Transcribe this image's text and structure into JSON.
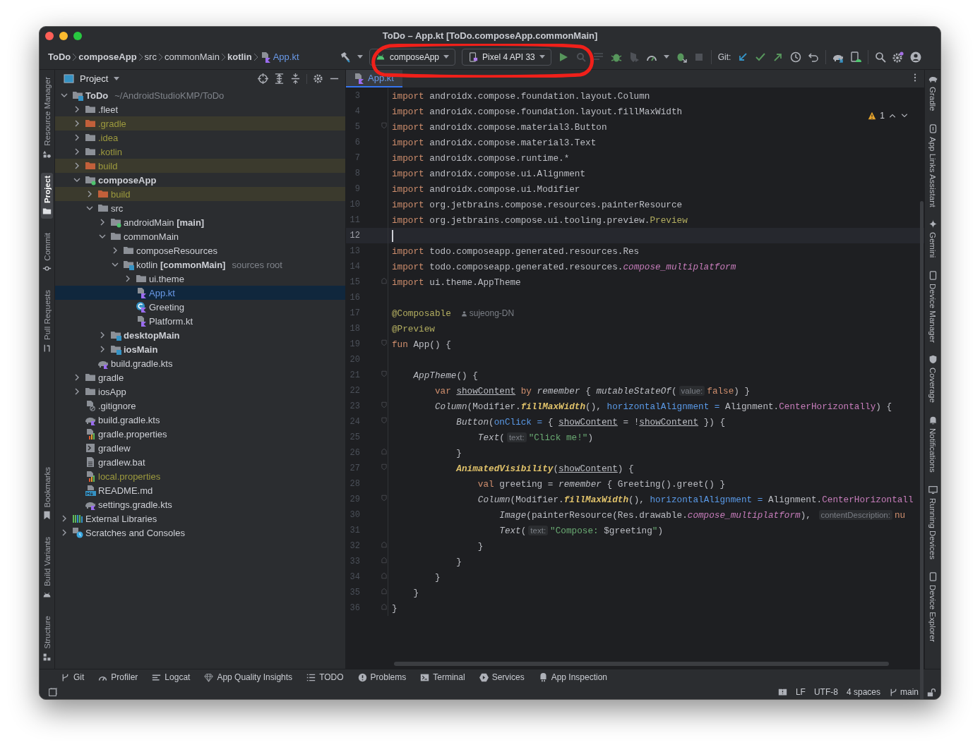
{
  "window": {
    "title": "ToDo – App.kt [ToDo.composeApp.commonMain]"
  },
  "breadcrumbs": [
    {
      "label": "ToDo",
      "bold": true
    },
    {
      "label": "composeApp",
      "bold": true
    },
    {
      "label": "src",
      "bold": false
    },
    {
      "label": "commonMain",
      "bold": false
    },
    {
      "label": "kotlin",
      "bold": true
    },
    {
      "label": "App.kt",
      "bold": false,
      "kind": "kotlin-file"
    }
  ],
  "run_config": {
    "label": "composeApp"
  },
  "device": {
    "label": "Pixel 4 API 33"
  },
  "git_label": "Git:",
  "left_stripe": {
    "top": [
      {
        "kind": "resources",
        "label": "Resource Manager",
        "selected": false
      },
      {
        "kind": "project",
        "label": "Project",
        "selected": true
      },
      {
        "kind": "commit",
        "label": "Commit",
        "selected": false
      },
      {
        "kind": "pull",
        "label": "Pull Requests",
        "selected": false
      }
    ],
    "bottom": [
      {
        "kind": "bookmark",
        "label": "Bookmarks",
        "selected": false
      },
      {
        "kind": "variants",
        "label": "Build Variants",
        "selected": false
      },
      {
        "kind": "structure",
        "label": "Structure",
        "selected": false
      }
    ]
  },
  "project_panel": {
    "title": "Project",
    "tree": [
      {
        "label": "ToDo",
        "hint": "~/AndroidStudioKMP/ToDo",
        "kind": "source-folder",
        "bold": true,
        "ignored": false,
        "expanded": true,
        "selected": false,
        "children": [
          {
            "label": ".fleet",
            "kind": "folder",
            "bold": false,
            "ignored": false,
            "expanded": false,
            "selected": false
          },
          {
            "label": ".gradle",
            "kind": "excluded-folder",
            "bold": false,
            "ignored": true,
            "expanded": false,
            "selected": false
          },
          {
            "label": ".idea",
            "kind": "folder",
            "bold": false,
            "ignored": true,
            "expanded": false,
            "selected": false
          },
          {
            "label": ".kotlin",
            "kind": "folder",
            "bold": false,
            "ignored": true,
            "expanded": false,
            "selected": false
          },
          {
            "label": "build",
            "kind": "excluded-folder",
            "bold": false,
            "ignored": true,
            "expanded": false,
            "selected": false
          },
          {
            "label": "composeApp",
            "kind": "android-folder",
            "bold": true,
            "ignored": false,
            "expanded": true,
            "selected": false,
            "children": [
              {
                "label": "build",
                "kind": "excluded-folder",
                "bold": false,
                "ignored": true,
                "expanded": false,
                "selected": false
              },
              {
                "label": "src",
                "kind": "folder",
                "bold": false,
                "ignored": false,
                "expanded": true,
                "selected": false,
                "children": [
                  {
                    "label": "androidMain **[main]**",
                    "kind": "android-folder",
                    "bold": false,
                    "ignored": false,
                    "expanded": false,
                    "selected": false
                  },
                  {
                    "label": "commonMain",
                    "kind": "folder",
                    "bold": false,
                    "ignored": false,
                    "expanded": true,
                    "selected": false,
                    "children": [
                      {
                        "label": "composeResources",
                        "kind": "folder",
                        "bold": false,
                        "ignored": false,
                        "expanded": false,
                        "selected": false
                      },
                      {
                        "label": "kotlin **[commonMain]**",
                        "hint": "sources root",
                        "kind": "source-folder",
                        "bold": false,
                        "ignored": false,
                        "expanded": true,
                        "selected": false,
                        "children": [
                          {
                            "label": "ui.theme",
                            "kind": "folder",
                            "bold": false,
                            "ignored": false,
                            "expanded": false,
                            "selected": false
                          },
                          {
                            "label": "App.kt",
                            "kind": "kotlin-file",
                            "bold": false,
                            "ignored": false,
                            "selected": true
                          },
                          {
                            "label": "Greeting",
                            "kind": "kotlin-class",
                            "bold": false,
                            "ignored": false,
                            "selected": false
                          },
                          {
                            "label": "Platform.kt",
                            "kind": "kotlin-file",
                            "bold": false,
                            "ignored": false,
                            "selected": false
                          }
                        ]
                      }
                    ]
                  },
                  {
                    "label": "desktopMain",
                    "kind": "source-folder",
                    "bold": true,
                    "ignored": false,
                    "expanded": false,
                    "selected": false
                  },
                  {
                    "label": "iosMain",
                    "kind": "source-folder",
                    "bold": true,
                    "ignored": false,
                    "expanded": false,
                    "selected": false
                  }
                ]
              },
              {
                "label": "build.gradle.kts",
                "kind": "gradle-file",
                "bold": false,
                "ignored": false,
                "selected": false
              }
            ]
          },
          {
            "label": "gradle",
            "kind": "folder",
            "bold": false,
            "ignored": false,
            "expanded": false,
            "selected": false
          },
          {
            "label": "iosApp",
            "kind": "folder",
            "bold": false,
            "ignored": false,
            "expanded": false,
            "selected": false
          },
          {
            "label": ".gitignore",
            "kind": "ignore-file",
            "bold": false,
            "ignored": false,
            "selected": false
          },
          {
            "label": "build.gradle.kts",
            "kind": "gradle-file",
            "bold": false,
            "ignored": false,
            "selected": false
          },
          {
            "label": "gradle.properties",
            "kind": "properties-file",
            "bold": false,
            "ignored": false,
            "selected": false
          },
          {
            "label": "gradlew",
            "kind": "shell-file",
            "bold": false,
            "ignored": false,
            "selected": false
          },
          {
            "label": "gradlew.bat",
            "kind": "text-file",
            "bold": false,
            "ignored": false,
            "selected": false
          },
          {
            "label": "local.properties",
            "kind": "properties-file",
            "bold": false,
            "ignored": true,
            "selected": false
          },
          {
            "label": "README.md",
            "kind": "markdown-file",
            "bold": false,
            "ignored": false,
            "selected": false
          },
          {
            "label": "settings.gradle.kts",
            "kind": "gradle-file",
            "bold": false,
            "ignored": false,
            "selected": false
          }
        ]
      },
      {
        "label": "External Libraries",
        "kind": "libraries",
        "bold": false,
        "ignored": false,
        "expanded": false,
        "selected": false
      },
      {
        "label": "Scratches and Consoles",
        "kind": "scratches",
        "bold": false,
        "ignored": false,
        "expanded": false,
        "selected": false
      }
    ]
  },
  "editor": {
    "tabs": [
      {
        "label": "App.kt",
        "selected": true
      }
    ],
    "warnings": "1",
    "lines": [
      {
        "n": "3",
        "current": false,
        "tokens": [
          {
            "kind": "kw",
            "text": "import"
          },
          {
            "kind": "plain",
            "text": " androidx.compose.foundation.layout.Column"
          }
        ]
      },
      {
        "n": "4",
        "current": false,
        "tokens": [
          {
            "kind": "kw",
            "text": "import"
          },
          {
            "kind": "plain",
            "text": " androidx.compose.foundation.layout.fillMaxWidth"
          }
        ]
      },
      {
        "n": "5",
        "current": false,
        "fold_start": true,
        "fold_end": false,
        "tokens": [
          {
            "kind": "kw",
            "text": "import"
          },
          {
            "kind": "plain",
            "text": " androidx.compose.material3.Button"
          }
        ]
      },
      {
        "n": "6",
        "current": false,
        "tokens": [
          {
            "kind": "kw",
            "text": "import"
          },
          {
            "kind": "plain",
            "text": " androidx.compose.material3.Text"
          }
        ]
      },
      {
        "n": "7",
        "current": false,
        "tokens": [
          {
            "kind": "kw",
            "text": "import"
          },
          {
            "kind": "plain",
            "text": " androidx.compose.runtime.*"
          }
        ]
      },
      {
        "n": "8",
        "current": false,
        "tokens": [
          {
            "kind": "kw",
            "text": "import"
          },
          {
            "kind": "plain",
            "text": " androidx.compose.ui.Alignment"
          }
        ]
      },
      {
        "n": "9",
        "current": false,
        "tokens": [
          {
            "kind": "kw",
            "text": "import"
          },
          {
            "kind": "plain",
            "text": " androidx.compose.ui.Modifier"
          }
        ]
      },
      {
        "n": "10",
        "current": false,
        "tokens": [
          {
            "kind": "kw",
            "text": "import"
          },
          {
            "kind": "plain",
            "text": " org.jetbrains.compose.resources.painterResource"
          }
        ]
      },
      {
        "n": "11",
        "current": false,
        "tokens": [
          {
            "kind": "kw",
            "text": "import"
          },
          {
            "kind": "plain",
            "text": " org.jetbrains.compose.ui.tooling.preview."
          },
          {
            "kind": "ann",
            "text": "Preview"
          }
        ]
      },
      {
        "n": "12",
        "current": true
      },
      {
        "n": "13",
        "current": false,
        "tokens": [
          {
            "kind": "kw",
            "text": "import"
          },
          {
            "kind": "plain",
            "text": " todo.composeapp.generated.resources.Res"
          }
        ]
      },
      {
        "n": "14",
        "current": false,
        "tokens": [
          {
            "kind": "kw",
            "text": "import"
          },
          {
            "kind": "plain",
            "text": " todo.composeapp.generated.resources."
          },
          {
            "kind": "propi",
            "text": "compose_multiplatform"
          }
        ]
      },
      {
        "n": "15",
        "current": false,
        "fold_start": false,
        "fold_end": true,
        "tokens": [
          {
            "kind": "kw",
            "text": "import"
          },
          {
            "kind": "plain",
            "text": " ui.theme.AppTheme"
          }
        ]
      },
      {
        "n": "16",
        "current": false
      },
      {
        "n": "17",
        "current": false,
        "tokens": [
          {
            "kind": "ann",
            "text": "@Composable"
          },
          {
            "kind": "author",
            "text": "sujeong-DN"
          }
        ]
      },
      {
        "n": "18",
        "current": false,
        "tokens": [
          {
            "kind": "ann",
            "text": "@Preview"
          }
        ]
      },
      {
        "n": "19",
        "current": false,
        "fold_start": true,
        "fold_end": false,
        "tokens": [
          {
            "kind": "kw",
            "text": "fun"
          },
          {
            "kind": "plain",
            "text": " App() {"
          }
        ]
      },
      {
        "n": "20",
        "current": false
      },
      {
        "n": "21",
        "current": false,
        "fold_start": true,
        "fold_end": false,
        "tokens": [
          {
            "kind": "ital",
            "text": "    AppTheme"
          },
          {
            "kind": "plain",
            "text": "() {"
          }
        ]
      },
      {
        "n": "22",
        "current": false,
        "tokens": [
          {
            "kind": "kw",
            "text": "        var "
          },
          {
            "kind": "under",
            "text": "showContent"
          },
          {
            "kind": "kw",
            "text": " by "
          },
          {
            "kind": "ital",
            "text": "remember"
          },
          {
            "kind": "plain",
            "text": " { "
          },
          {
            "kind": "ital",
            "text": "mutableStateOf"
          },
          {
            "kind": "plain",
            "text": "("
          },
          {
            "kind": "hint",
            "text": "value:"
          },
          {
            "kind": "kw",
            "text": "false"
          },
          {
            "kind": "plain",
            "text": ") }"
          }
        ]
      },
      {
        "n": "23",
        "current": false,
        "fold_start": true,
        "fold_end": false,
        "tokens": [
          {
            "kind": "ital",
            "text": "        Column"
          },
          {
            "kind": "plain",
            "text": "(Modifier."
          },
          {
            "kind": "fnc",
            "text": "fillMaxWidth"
          },
          {
            "kind": "plain",
            "text": "(), "
          },
          {
            "kind": "named",
            "text": "horizontalAlignment ="
          },
          {
            "kind": "plain",
            "text": " Alignment."
          },
          {
            "kind": "prop",
            "text": "CenterHorizontally"
          },
          {
            "kind": "plain",
            "text": ") {"
          }
        ]
      },
      {
        "n": "24",
        "current": false,
        "fold_start": true,
        "fold_end": false,
        "tokens": [
          {
            "kind": "ital",
            "text": "            Button"
          },
          {
            "kind": "plain",
            "text": "("
          },
          {
            "kind": "named",
            "text": "onClick ="
          },
          {
            "kind": "plain",
            "text": " { "
          },
          {
            "kind": "under",
            "text": "showContent"
          },
          {
            "kind": "plain",
            "text": " = !"
          },
          {
            "kind": "under",
            "text": "showContent"
          },
          {
            "kind": "plain",
            "text": " }) {"
          }
        ]
      },
      {
        "n": "25",
        "current": false,
        "tokens": [
          {
            "kind": "ital",
            "text": "                Text"
          },
          {
            "kind": "plain",
            "text": "("
          },
          {
            "kind": "hint",
            "text": "text:"
          },
          {
            "kind": "str",
            "text": "\"Click me!\""
          },
          {
            "kind": "plain",
            "text": ")"
          }
        ]
      },
      {
        "n": "26",
        "current": false,
        "fold_start": false,
        "fold_end": true,
        "tokens": [
          {
            "kind": "plain",
            "text": "            }"
          }
        ]
      },
      {
        "n": "27",
        "current": false,
        "fold_start": true,
        "fold_end": false,
        "tokens": [
          {
            "kind": "fnc",
            "text": "            AnimatedVisibility"
          },
          {
            "kind": "plain",
            "text": "("
          },
          {
            "kind": "under",
            "text": "showContent"
          },
          {
            "kind": "plain",
            "text": ") {"
          }
        ]
      },
      {
        "n": "28",
        "current": false,
        "tokens": [
          {
            "kind": "kw",
            "text": "                val"
          },
          {
            "kind": "plain",
            "text": " greeting = "
          },
          {
            "kind": "ital",
            "text": "remember"
          },
          {
            "kind": "plain",
            "text": " { Greeting().greet() }"
          }
        ]
      },
      {
        "n": "29",
        "current": false,
        "fold_start": true,
        "fold_end": false,
        "tokens": [
          {
            "kind": "ital",
            "text": "                Column"
          },
          {
            "kind": "plain",
            "text": "(Modifier."
          },
          {
            "kind": "fnc",
            "text": "fillMaxWidth"
          },
          {
            "kind": "plain",
            "text": "(), "
          },
          {
            "kind": "named",
            "text": "horizontalAlignment ="
          },
          {
            "kind": "plain",
            "text": " Alignment."
          },
          {
            "kind": "prop",
            "text": "CenterHorizontall"
          }
        ]
      },
      {
        "n": "30",
        "current": false,
        "tokens": [
          {
            "kind": "ital",
            "text": "                    Image"
          },
          {
            "kind": "plain",
            "text": "(painterResource(Res.drawable."
          },
          {
            "kind": "propi",
            "text": "compose_multiplatform"
          },
          {
            "kind": "plain",
            "text": "), "
          },
          {
            "kind": "hint",
            "text": "contentDescription:"
          },
          {
            "kind": "kw",
            "text": "nu"
          }
        ]
      },
      {
        "n": "31",
        "current": false,
        "tokens": [
          {
            "kind": "ital",
            "text": "                    Text"
          },
          {
            "kind": "plain",
            "text": "("
          },
          {
            "kind": "hint",
            "text": "text:"
          },
          {
            "kind": "str",
            "text": "\"Compose: "
          },
          {
            "kind": "plain",
            "text": "$greeting"
          },
          {
            "kind": "str",
            "text": "\""
          },
          {
            "kind": "plain",
            "text": ")"
          }
        ]
      },
      {
        "n": "32",
        "current": false,
        "fold_start": false,
        "fold_end": true,
        "tokens": [
          {
            "kind": "plain",
            "text": "                }"
          }
        ]
      },
      {
        "n": "33",
        "current": false,
        "fold_start": false,
        "fold_end": true,
        "tokens": [
          {
            "kind": "plain",
            "text": "            }"
          }
        ]
      },
      {
        "n": "34",
        "current": false,
        "fold_start": false,
        "fold_end": true,
        "tokens": [
          {
            "kind": "plain",
            "text": "        }"
          }
        ]
      },
      {
        "n": "35",
        "current": false,
        "fold_start": false,
        "fold_end": true,
        "tokens": [
          {
            "kind": "plain",
            "text": "    }"
          }
        ]
      },
      {
        "n": "36",
        "current": false,
        "fold_start": false,
        "fold_end": true,
        "tokens": [
          {
            "kind": "plain",
            "text": "}"
          }
        ]
      }
    ]
  },
  "right_stripe": [
    {
      "kind": "gradle",
      "label": "Gradle"
    },
    {
      "kind": "links",
      "label": "App Links Assistant"
    },
    {
      "kind": "gemini",
      "label": "Gemini"
    },
    {
      "kind": "device",
      "label": "Device Manager"
    },
    {
      "kind": "coverage",
      "label": "Coverage"
    },
    {
      "kind": "bell",
      "label": "Notifications"
    },
    {
      "kind": "running",
      "label": "Running Devices"
    },
    {
      "kind": "device",
      "label": "Device Explorer"
    }
  ],
  "tool_windows": [
    {
      "kind": "git",
      "label": "Git"
    },
    {
      "kind": "profiler",
      "label": "Profiler"
    },
    {
      "kind": "logcat",
      "label": "Logcat"
    },
    {
      "kind": "quality",
      "label": "App Quality Insights"
    },
    {
      "kind": "todo",
      "label": "TODO"
    },
    {
      "kind": "problems",
      "label": "Problems"
    },
    {
      "kind": "terminal",
      "label": "Terminal"
    },
    {
      "kind": "services",
      "label": "Services"
    },
    {
      "kind": "inspection",
      "label": "App Inspection"
    }
  ],
  "status_bar": {
    "items": [
      "LF",
      "UTF-8",
      "4 spaces"
    ],
    "branch": "main"
  }
}
